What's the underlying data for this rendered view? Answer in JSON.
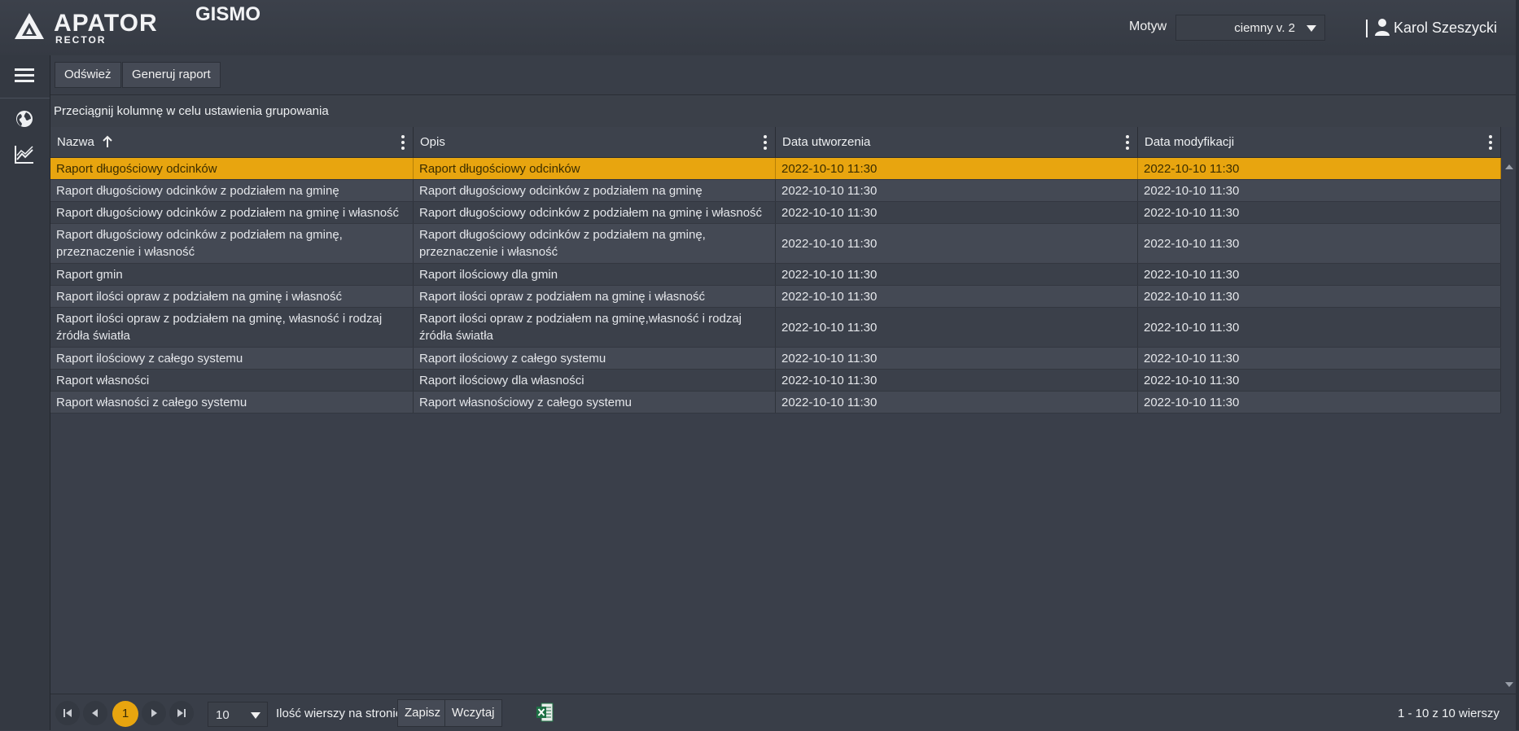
{
  "header": {
    "logo_main": "APATOR",
    "logo_sub": "RECTOR",
    "app_title": "GISMO",
    "theme_label": "Motyw",
    "theme_value": "ciemny v. 2",
    "user_name": "Karol Szeszycki"
  },
  "toolbar": {
    "refresh_label": "Odśwież",
    "generate_label": "Generuj raport"
  },
  "group_bar": {
    "hint": "Przeciągnij kolumnę w celu ustawienia grupowania"
  },
  "grid": {
    "columns": [
      "Nazwa",
      "Opis",
      "Data utworzenia",
      "Data modyfikacji"
    ],
    "sort": {
      "column": "Nazwa",
      "direction": "ascending"
    },
    "selected_row": 0,
    "rows": [
      {
        "name": "Raport długościowy odcinków",
        "desc": "Raport długościowy odcinków",
        "created": "2022-10-10 11:30",
        "modified": "2022-10-10 11:30"
      },
      {
        "name": "Raport długościowy odcinków z podziałem na gminę",
        "desc": "Raport długościowy odcinków z podziałem na gminę",
        "created": "2022-10-10 11:30",
        "modified": "2022-10-10 11:30"
      },
      {
        "name": "Raport długościowy odcinków z podziałem na gminę i własność",
        "desc": "Raport długościowy odcinków z podziałem na gminę i własność",
        "created": "2022-10-10 11:30",
        "modified": "2022-10-10 11:30"
      },
      {
        "name": "Raport długościowy odcinków z podziałem na gminę, przeznaczenie i własność",
        "desc": "Raport długościowy odcinków z podziałem na gminę, przeznaczenie i własność",
        "created": "2022-10-10 11:30",
        "modified": "2022-10-10 11:30"
      },
      {
        "name": "Raport gmin",
        "desc": "Raport ilościowy dla gmin",
        "created": "2022-10-10 11:30",
        "modified": "2022-10-10 11:30"
      },
      {
        "name": "Raport ilości opraw z podziałem na gminę i własność",
        "desc": "Raport ilości opraw z podziałem na gminę i własność",
        "created": "2022-10-10 11:30",
        "modified": "2022-10-10 11:30"
      },
      {
        "name": "Raport ilości opraw z podziałem na gminę, własność i rodzaj źródła światła",
        "desc": "Raport ilości opraw z podziałem na gminę,własność i rodzaj źródła światła",
        "created": "2022-10-10 11:30",
        "modified": "2022-10-10 11:30"
      },
      {
        "name": "Raport ilościowy z całego systemu",
        "desc": "Raport ilościowy z całego systemu",
        "created": "2022-10-10 11:30",
        "modified": "2022-10-10 11:30"
      },
      {
        "name": "Raport własności",
        "desc": "Raport ilościowy dla własności",
        "created": "2022-10-10 11:30",
        "modified": "2022-10-10 11:30"
      },
      {
        "name": "Raport własności z całego systemu",
        "desc": "Raport własnościowy z całego systemu",
        "created": "2022-10-10 11:30",
        "modified": "2022-10-10 11:30"
      }
    ]
  },
  "pager": {
    "current_page": "1",
    "page_size": "10",
    "rows_per_page_label": "Ilość wierszy na stronie",
    "save_label": "Zapisz",
    "load_label": "Wczytaj",
    "count_label": "1 - 10 z 10 wierszy"
  },
  "icons": {
    "sidebar": [
      "menu-icon",
      "globe-icon",
      "chart-icon"
    ],
    "pager": [
      "first-page-icon",
      "prev-page-icon",
      "next-page-icon",
      "last-page-icon",
      "excel-icon"
    ]
  },
  "colors": {
    "accent": "#e8a50f",
    "background": "#3a3f4a"
  }
}
